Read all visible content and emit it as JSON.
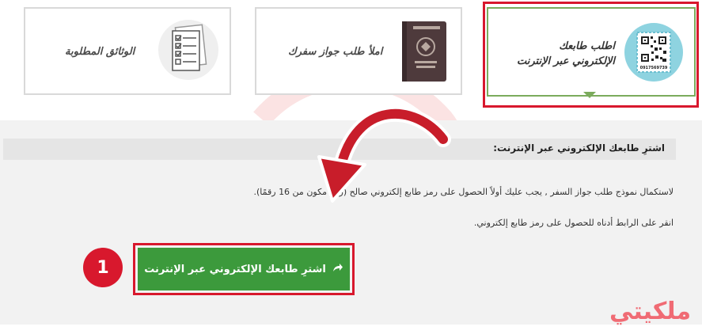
{
  "steps": [
    {
      "title": "الوثائق المطلوبة",
      "icon": "checklist-icon"
    },
    {
      "title": "املأ طلب جواز سفرك",
      "icon": "passport-icon"
    },
    {
      "title_line1": "اطلب طابعك",
      "title_line2": "الإلكتروني عبر الإنترنت",
      "icon": "stamp-qr-icon",
      "stamp_code": "0917569739"
    }
  ],
  "section": {
    "heading": "اشترِ طابعك الإلكتروني عبر الإنترنت:",
    "paragraph1": "لاستكمال نموذج طلب جواز السفر , يجب عليك أولاً الحصول على رمز طابع إلكتروني صالح (رمز مكون من 16 رقمًا).",
    "paragraph2": "انقر على الرابط أدناه للحصول على رمز طابع إلكتروني."
  },
  "cta": {
    "label": "اشترِ طابعك الإلكتروني عبر الإنترنت",
    "icon": "share-arrow-icon"
  },
  "step_number": "1",
  "brand": "ملكيتي",
  "colors": {
    "accent_red": "#d8182d",
    "cta_green": "#3c9a3c",
    "card_active_border": "#7bab5c",
    "brand_pink": "#f06b74"
  }
}
